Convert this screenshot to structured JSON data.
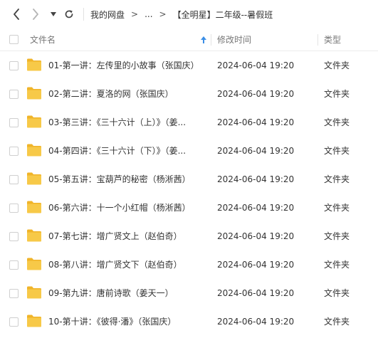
{
  "toolbar": {
    "back_icon": "chevron-left-icon",
    "forward_icon": "chevron-right-icon",
    "history_icon": "caret-down-icon",
    "refresh_icon": "refresh-icon"
  },
  "breadcrumb": {
    "root": "我的网盘",
    "sep1": ">",
    "ellipsis": "...",
    "sep2": ">",
    "current": "【全明星】二年级--暑假班"
  },
  "columns": {
    "name": "文件名",
    "mtime": "修改时间",
    "type": "类型"
  },
  "rows": [
    {
      "name": "01-第一讲：左传里的小故事（张国庆）",
      "time": "2024-06-04 19:20",
      "type": "文件夹"
    },
    {
      "name": "02-第二讲：夏洛的网（张国庆）",
      "time": "2024-06-04 19:20",
      "type": "文件夹"
    },
    {
      "name": "03-第三讲：《三十六计（上）》（姜...",
      "time": "2024-06-04 19:20",
      "type": "文件夹"
    },
    {
      "name": "04-第四讲：《三十六计（下）》（姜...",
      "time": "2024-06-04 19:20",
      "type": "文件夹"
    },
    {
      "name": "05-第五讲：宝葫芦的秘密（杨淅茜）",
      "time": "2024-06-04 19:20",
      "type": "文件夹"
    },
    {
      "name": "06-第六讲：十一个小红帽（杨淅茜）",
      "time": "2024-06-04 19:20",
      "type": "文件夹"
    },
    {
      "name": "07-第七讲：增广贤文上（赵伯奇）",
      "time": "2024-06-04 19:20",
      "type": "文件夹"
    },
    {
      "name": "08-第八讲：增广贤文下（赵伯奇）",
      "time": "2024-06-04 19:20",
      "type": "文件夹"
    },
    {
      "name": "09-第九讲：唐前诗歌（姜天一）",
      "time": "2024-06-04 19:20",
      "type": "文件夹"
    },
    {
      "name": "10-第十讲：《彼得·潘》（张国庆）",
      "time": "2024-06-04 19:20",
      "type": "文件夹"
    }
  ],
  "colors": {
    "folder": "#f7c948",
    "folder_back": "#f0b429",
    "sort_arrow": "#3a8ee6"
  }
}
